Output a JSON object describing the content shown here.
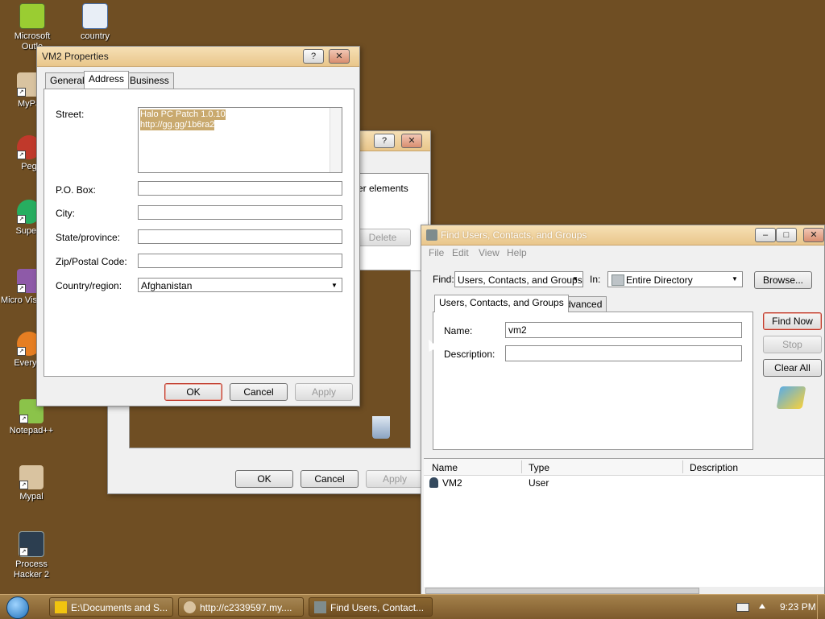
{
  "desktop": {
    "icons": [
      {
        "label": "Microsoft Outlo",
        "name": "outlook"
      },
      {
        "label": "country",
        "name": "country"
      },
      {
        "label": "MyPa",
        "name": "mypal-partial"
      },
      {
        "label": "Peg",
        "name": "peg"
      },
      {
        "label": "Superr",
        "name": "super"
      },
      {
        "label": "Micro Visual S",
        "name": "visual-studio"
      },
      {
        "label": "Everyth",
        "name": "everything"
      },
      {
        "label": "Notepad++",
        "name": "notepad"
      },
      {
        "label": "Mypal",
        "name": "mypal"
      },
      {
        "label": "Process Hacker 2",
        "name": "process-hacker"
      }
    ]
  },
  "props": {
    "title": "VM2 Properties",
    "help": "?",
    "close": "✕",
    "tabs": [
      "General",
      "Address",
      "Business"
    ],
    "active_tab": "Address",
    "street_label": "Street:",
    "street_lines": [
      "Halo PC Patch 1.0.10",
      "http://gg.gg/1b6ra2"
    ],
    "pobox_label": "P.O. Box:",
    "city_label": "City:",
    "state_label": "State/province:",
    "zip_label": "Zip/Postal Code:",
    "country_label": "Country/region:",
    "country_value": "Afghanistan",
    "ok": "OK",
    "cancel": "Cancel",
    "apply": "Apply"
  },
  "bgwin": {
    "help": "?",
    "close": "✕",
    "partial_text": "er elements",
    "delete": "Delete",
    "ok": "OK",
    "cancel": "Cancel",
    "apply": "Apply"
  },
  "find": {
    "title": "Find Users, Contacts, and Groups",
    "menu": [
      "File",
      "Edit",
      "View",
      "Help"
    ],
    "find_label": "Find:",
    "find_value": "Users, Contacts, and Groups",
    "in_label": "In:",
    "in_value": "Entire Directory",
    "browse": "Browse...",
    "tabs": [
      "Users, Contacts, and Groups",
      "Advanced"
    ],
    "name_label": "Name:",
    "name_value": "vm2",
    "desc_label": "Description:",
    "find_now": "Find Now",
    "stop": "Stop",
    "clear_all": "Clear All",
    "columns": [
      "Name",
      "Type",
      "Description"
    ],
    "rows": [
      {
        "name": "VM2",
        "type": "User",
        "description": ""
      }
    ]
  },
  "taskbar": {
    "items": [
      "E:\\Documents and S...",
      "http://c2339597.my....",
      "Find Users, Contact..."
    ],
    "clock": "9:23 PM"
  },
  "colors": {
    "desktop": "#6f4e23",
    "accent_default_button": "#c0392b"
  }
}
